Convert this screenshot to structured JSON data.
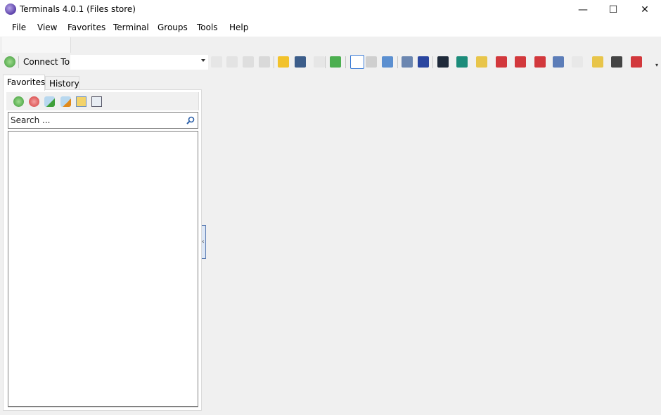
{
  "window": {
    "title": "Terminals 4.0.1 (Files store)",
    "controls": {
      "minimize": "—",
      "maximize": "☐",
      "close": "✕"
    }
  },
  "menu": [
    "File",
    "View",
    "Favorites",
    "Terminal",
    "Groups",
    "Tools",
    "Help"
  ],
  "toolbar": {
    "connect_label": "Connect To:",
    "connect_value": "",
    "icons": [
      "new-connection-icon",
      "screen-icon",
      "screen-settings-icon",
      "screen-disabled-icon",
      "plug-icon",
      "favorite-star-icon",
      "organize-favorites-icon",
      "keyboard-icon",
      "fullscreen-icon",
      "code-view-icon",
      "camera-icon",
      "screen-capture-icon",
      "computer-network-icon",
      "computer-icon",
      "terminal-console-icon",
      "network-tool-icon",
      "edit-terminal-icon",
      "toolbox-icon-1",
      "toolbox-icon-2",
      "toolbox-icon-3",
      "network-map-icon",
      "settings-document-icon",
      "lock-server-icon",
      "printer-icon",
      "toolbox-icon-4"
    ],
    "overflow": "▾"
  },
  "sidebar": {
    "tabs": [
      {
        "label": "Favorites",
        "active": true
      },
      {
        "label": "History",
        "active": false
      }
    ],
    "tools": [
      "add-favorite-icon",
      "remove-favorite-icon",
      "add-tag-icon",
      "remove-tag-icon",
      "import-icon",
      "collapse-all-icon"
    ],
    "search_placeholder": "Search ..."
  },
  "splitter": {
    "glyph": "‹"
  }
}
